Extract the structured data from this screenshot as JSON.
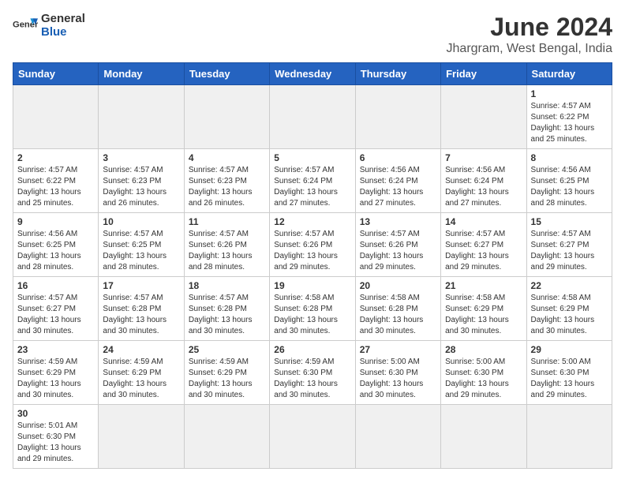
{
  "header": {
    "logo_general": "General",
    "logo_blue": "Blue",
    "month_title": "June 2024",
    "location": "Jhargram, West Bengal, India"
  },
  "weekdays": [
    "Sunday",
    "Monday",
    "Tuesday",
    "Wednesday",
    "Thursday",
    "Friday",
    "Saturday"
  ],
  "days": [
    {
      "num": "1",
      "sunrise": "4:57 AM",
      "sunset": "6:22 PM",
      "daylight": "13 hours and 25 minutes."
    },
    {
      "num": "2",
      "sunrise": "4:57 AM",
      "sunset": "6:22 PM",
      "daylight": "13 hours and 25 minutes."
    },
    {
      "num": "3",
      "sunrise": "4:57 AM",
      "sunset": "6:23 PM",
      "daylight": "13 hours and 26 minutes."
    },
    {
      "num": "4",
      "sunrise": "4:57 AM",
      "sunset": "6:23 PM",
      "daylight": "13 hours and 26 minutes."
    },
    {
      "num": "5",
      "sunrise": "4:57 AM",
      "sunset": "6:24 PM",
      "daylight": "13 hours and 27 minutes."
    },
    {
      "num": "6",
      "sunrise": "4:56 AM",
      "sunset": "6:24 PM",
      "daylight": "13 hours and 27 minutes."
    },
    {
      "num": "7",
      "sunrise": "4:56 AM",
      "sunset": "6:24 PM",
      "daylight": "13 hours and 27 minutes."
    },
    {
      "num": "8",
      "sunrise": "4:56 AM",
      "sunset": "6:25 PM",
      "daylight": "13 hours and 28 minutes."
    },
    {
      "num": "9",
      "sunrise": "4:56 AM",
      "sunset": "6:25 PM",
      "daylight": "13 hours and 28 minutes."
    },
    {
      "num": "10",
      "sunrise": "4:57 AM",
      "sunset": "6:25 PM",
      "daylight": "13 hours and 28 minutes."
    },
    {
      "num": "11",
      "sunrise": "4:57 AM",
      "sunset": "6:26 PM",
      "daylight": "13 hours and 28 minutes."
    },
    {
      "num": "12",
      "sunrise": "4:57 AM",
      "sunset": "6:26 PM",
      "daylight": "13 hours and 29 minutes."
    },
    {
      "num": "13",
      "sunrise": "4:57 AM",
      "sunset": "6:26 PM",
      "daylight": "13 hours and 29 minutes."
    },
    {
      "num": "14",
      "sunrise": "4:57 AM",
      "sunset": "6:27 PM",
      "daylight": "13 hours and 29 minutes."
    },
    {
      "num": "15",
      "sunrise": "4:57 AM",
      "sunset": "6:27 PM",
      "daylight": "13 hours and 29 minutes."
    },
    {
      "num": "16",
      "sunrise": "4:57 AM",
      "sunset": "6:27 PM",
      "daylight": "13 hours and 30 minutes."
    },
    {
      "num": "17",
      "sunrise": "4:57 AM",
      "sunset": "6:28 PM",
      "daylight": "13 hours and 30 minutes."
    },
    {
      "num": "18",
      "sunrise": "4:57 AM",
      "sunset": "6:28 PM",
      "daylight": "13 hours and 30 minutes."
    },
    {
      "num": "19",
      "sunrise": "4:58 AM",
      "sunset": "6:28 PM",
      "daylight": "13 hours and 30 minutes."
    },
    {
      "num": "20",
      "sunrise": "4:58 AM",
      "sunset": "6:28 PM",
      "daylight": "13 hours and 30 minutes."
    },
    {
      "num": "21",
      "sunrise": "4:58 AM",
      "sunset": "6:29 PM",
      "daylight": "13 hours and 30 minutes."
    },
    {
      "num": "22",
      "sunrise": "4:58 AM",
      "sunset": "6:29 PM",
      "daylight": "13 hours and 30 minutes."
    },
    {
      "num": "23",
      "sunrise": "4:59 AM",
      "sunset": "6:29 PM",
      "daylight": "13 hours and 30 minutes."
    },
    {
      "num": "24",
      "sunrise": "4:59 AM",
      "sunset": "6:29 PM",
      "daylight": "13 hours and 30 minutes."
    },
    {
      "num": "25",
      "sunrise": "4:59 AM",
      "sunset": "6:29 PM",
      "daylight": "13 hours and 30 minutes."
    },
    {
      "num": "26",
      "sunrise": "4:59 AM",
      "sunset": "6:30 PM",
      "daylight": "13 hours and 30 minutes."
    },
    {
      "num": "27",
      "sunrise": "5:00 AM",
      "sunset": "6:30 PM",
      "daylight": "13 hours and 30 minutes."
    },
    {
      "num": "28",
      "sunrise": "5:00 AM",
      "sunset": "6:30 PM",
      "daylight": "13 hours and 29 minutes."
    },
    {
      "num": "29",
      "sunrise": "5:00 AM",
      "sunset": "6:30 PM",
      "daylight": "13 hours and 29 minutes."
    },
    {
      "num": "30",
      "sunrise": "5:01 AM",
      "sunset": "6:30 PM",
      "daylight": "13 hours and 29 minutes."
    }
  ]
}
